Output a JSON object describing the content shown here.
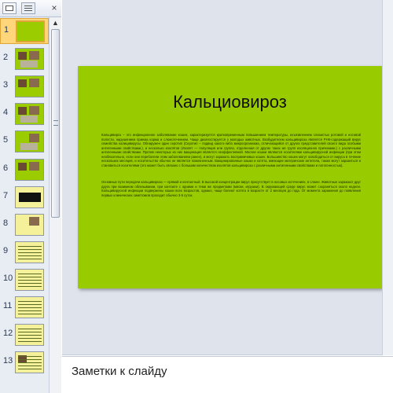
{
  "thumb_panel": {
    "tabs": {
      "close_label": "×"
    },
    "slides": [
      {
        "number": "1",
        "selected": true
      },
      {
        "number": "2",
        "selected": false
      },
      {
        "number": "3",
        "selected": false
      },
      {
        "number": "4",
        "selected": false
      },
      {
        "number": "5",
        "selected": false
      },
      {
        "number": "6",
        "selected": false
      },
      {
        "number": "7",
        "selected": false
      },
      {
        "number": "8",
        "selected": false
      },
      {
        "number": "9",
        "selected": false
      },
      {
        "number": "10",
        "selected": false
      },
      {
        "number": "11",
        "selected": false
      },
      {
        "number": "12",
        "selected": false
      },
      {
        "number": "13",
        "selected": false
      }
    ]
  },
  "slide": {
    "title": "Кальциовироз",
    "body_paragraph_1": "Кальцивироз – это инфекционное заболевание кошек, характеризуется кратковременным повышением температуры, изъязвлением слизистых ротовой и носовой полости, нарушением приема корма и слюнотечением. Чаще диагностируется у молодых животных. Возбудителем кальцивироза является РНК-содержащий вирус семейства калицивирусы. Обнаружен один серотип (Серотип – подвид какого-либо микроорганизма, отличающийся от других представителей своего вида особыми антигенными свойствами.), и несколько изолятов (Изолят — популяция или группа, отделенная от других таких же групп изоляционно причинами.) с различными антигенными свойствами. Против некоторых из них вакцинация является неэффективной. Многие кошки являются носителями кальцивирусной инфекции (при этом необязательно, если они переболели этим заболеванием ранее), и могут заражать восприимчивых кошек. Большинство кошек могут освободиться от вируса в течение нескольких месяцев, и носительство обычно не является пожизненным. Вакцинированные кошки и котята, имеющие материнские антитела, также могут заразиться и становиться носителями (это может быть связано с большим количеством изолятов кальцивироза с различными антигенными свойствами и патогенностью).",
    "body_paragraph_2": "Основные пути передачи кальцивироза — прямой и контактный. В высокой концентрации вирус присутствует в носовых истечениях, в слюне. Животные заражают друг друга при взаимном облизывании, при контакте с одними и теми же предметами (миски, игрушки). В окружающей среде вирус может сохраняться около недели. Кальцивирусной инфекции подвержены кошки всех возрастов, однако, чаще болеют котята в возрасте от 2 месяцев до года. От момента заражения до появления первых клинических симптомов проходит обычно 3-5 суток."
  },
  "notes": {
    "placeholder": "Заметки к слайду"
  },
  "colors": {
    "slide_background": "#99cc00",
    "selection_highlight": "#ffd77a"
  }
}
